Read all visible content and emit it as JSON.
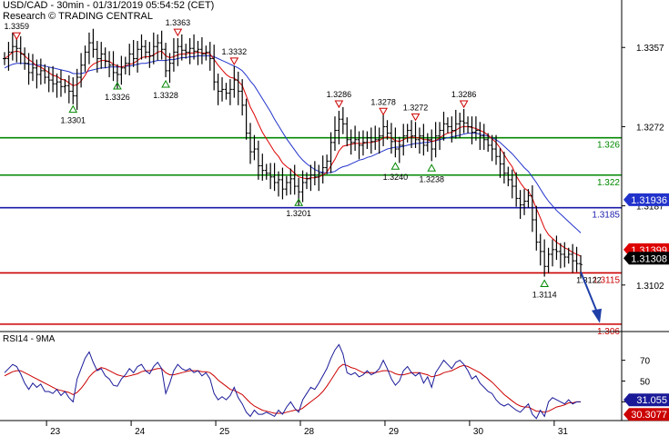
{
  "header": {
    "title": "USD/CAD - 30min - 01/31/2019 05:54:52 (CET)",
    "subtitle": "Research © TRADING CENTRAL"
  },
  "rsi_title": "RSI14 - 9MA",
  "colors": {
    "price": "#000000",
    "ma_fast": "#dd0000",
    "ma_slow": "#2233cc",
    "support_green": "#008800",
    "pivot_blue": "#1a1aaa",
    "resistance_red": "#cc0000",
    "arrow": "#1f3fa8",
    "rsi": "#1a1a99",
    "rsi_ma": "#cc0000"
  },
  "chart_data": [
    {
      "type": "line",
      "panel": "price",
      "ylim": [
        1.3055,
        1.3405
      ],
      "x_labels": [
        "23",
        "24",
        "25",
        "28",
        "29",
        "30",
        "31"
      ],
      "y_ticks": [
        1.3357,
        1.3272,
        1.3187,
        1.3102
      ],
      "right_scale_labels": [
        "1.3357",
        "1.3272",
        "1.3187",
        "1.3102"
      ],
      "current_price": "1.31308",
      "fast_ma_value": "1.31399",
      "slow_ma_value": "1.31936",
      "levels": [
        {
          "value": 1.326,
          "label": "1.326",
          "color": "#008800"
        },
        {
          "value": 1.322,
          "label": "1.322",
          "color": "#008800"
        },
        {
          "value": 1.3185,
          "label": "1.3185",
          "color": "#1a1aaa"
        },
        {
          "value": 1.3115,
          "label": "1.3115",
          "color": "#cc0000"
        },
        {
          "value": 1.306,
          "label": "1.306",
          "color": "#cc0000"
        }
      ],
      "annotations": [
        {
          "text": "1.3359",
          "i": 3,
          "y": 1.3359,
          "kind": "high"
        },
        {
          "text": "1.3363",
          "i": 43,
          "y": 1.3363,
          "kind": "high"
        },
        {
          "text": "1.3332",
          "i": 57,
          "y": 1.3332,
          "kind": "high"
        },
        {
          "text": "1.3301",
          "i": 17,
          "y": 1.3301,
          "kind": "low"
        },
        {
          "text": "1.3326",
          "i": 28,
          "y": 1.3326,
          "kind": "low"
        },
        {
          "text": "1.3328",
          "i": 40,
          "y": 1.3328,
          "kind": "low"
        },
        {
          "text": "1.3286",
          "i": 83,
          "y": 1.3286,
          "kind": "high"
        },
        {
          "text": "1.3278",
          "i": 94,
          "y": 1.3278,
          "kind": "high"
        },
        {
          "text": "1.3272",
          "i": 102,
          "y": 1.3272,
          "kind": "high"
        },
        {
          "text": "1.3286",
          "i": 114,
          "y": 1.3286,
          "kind": "high"
        },
        {
          "text": "1.3201",
          "i": 73,
          "y": 1.3201,
          "kind": "low"
        },
        {
          "text": "1.3240",
          "i": 97,
          "y": 1.324,
          "kind": "low"
        },
        {
          "text": "1.3238",
          "i": 106,
          "y": 1.3238,
          "kind": "low"
        },
        {
          "text": "1.3114",
          "i": 134,
          "y": 1.3114,
          "kind": "low"
        },
        {
          "text": "1.3122",
          "i": 141,
          "y": 1.3122,
          "kind": "label"
        }
      ],
      "forecast_arrow": {
        "from": 1.3122,
        "to": 1.3063
      },
      "close": [
        1.3345,
        1.3352,
        1.3358,
        1.3356,
        1.335,
        1.334,
        1.333,
        1.3335,
        1.3328,
        1.3332,
        1.3325,
        1.3322,
        1.3318,
        1.332,
        1.3315,
        1.3316,
        1.331,
        1.3305,
        1.3325,
        1.3338,
        1.3352,
        1.3362,
        1.3355,
        1.3345,
        1.335,
        1.3342,
        1.3338,
        1.333,
        1.3328,
        1.3335,
        1.334,
        1.335,
        1.3345,
        1.3355,
        1.3358,
        1.3352,
        1.3348,
        1.3358,
        1.3362,
        1.3355,
        1.3332,
        1.334,
        1.3352,
        1.3358,
        1.3354,
        1.3352,
        1.3356,
        1.3353,
        1.3355,
        1.335,
        1.3352,
        1.3345,
        1.332,
        1.331,
        1.3312,
        1.3308,
        1.3312,
        1.3322,
        1.331,
        1.3295,
        1.3265,
        1.3245,
        1.3248,
        1.323,
        1.3225,
        1.3222,
        1.3218,
        1.3212,
        1.3215,
        1.3205,
        1.3212,
        1.3216,
        1.3208,
        1.3202,
        1.3212,
        1.3216,
        1.322,
        1.3218,
        1.3222,
        1.3228,
        1.3235,
        1.3255,
        1.3268,
        1.328,
        1.3275,
        1.3258,
        1.3255,
        1.3258,
        1.3252,
        1.3255,
        1.326,
        1.3256,
        1.3258,
        1.3262,
        1.3272,
        1.3265,
        1.3256,
        1.3248,
        1.3252,
        1.3262,
        1.3268,
        1.3262,
        1.3258,
        1.3262,
        1.3252,
        1.3258,
        1.3248,
        1.3262,
        1.3268,
        1.3275,
        1.3272,
        1.3268,
        1.3275,
        1.3278,
        1.3276,
        1.3272,
        1.3266,
        1.3268,
        1.3262,
        1.3258,
        1.3252,
        1.3248,
        1.324,
        1.3232,
        1.3222,
        1.3215,
        1.3208,
        1.3195,
        1.3188,
        1.3192,
        1.3198,
        1.3172,
        1.3148,
        1.3138,
        1.3122,
        1.3135,
        1.314,
        1.3138,
        1.3135,
        1.3132,
        1.3135,
        1.3128,
        1.3125,
        1.3124
      ],
      "fast_ma": [
        1.3345,
        1.3348,
        1.3352,
        1.3353,
        1.3352,
        1.3348,
        1.3344,
        1.3341,
        1.3337,
        1.3336,
        1.3333,
        1.333,
        1.3327,
        1.3326,
        1.3323,
        1.3322,
        1.3319,
        1.3316,
        1.3317,
        1.3321,
        1.3327,
        1.3335,
        1.3339,
        1.3341,
        1.3343,
        1.3343,
        1.3342,
        1.3339,
        1.3337,
        1.3336,
        1.3337,
        1.3339,
        1.334,
        1.3343,
        1.3346,
        1.3347,
        1.3347,
        1.3349,
        1.3352,
        1.3353,
        1.3348,
        1.3346,
        1.3347,
        1.3349,
        1.335,
        1.335,
        1.3351,
        1.3351,
        1.3352,
        1.3351,
        1.3351,
        1.335,
        1.3344,
        1.3338,
        1.3333,
        1.3328,
        1.3325,
        1.3324,
        1.3321,
        1.3316,
        1.3305,
        1.3293,
        1.3285,
        1.3275,
        1.3266,
        1.3259,
        1.3252,
        1.3245,
        1.324,
        1.3233,
        1.3229,
        1.3226,
        1.3222,
        1.3218,
        1.3217,
        1.3216,
        1.3217,
        1.3217,
        1.3218,
        1.322,
        1.3223,
        1.323,
        1.3237,
        1.3246,
        1.3251,
        1.3252,
        1.3253,
        1.3254,
        1.3254,
        1.3254,
        1.3255,
        1.3255,
        1.3256,
        1.3257,
        1.326,
        1.3261,
        1.326,
        1.3257,
        1.3256,
        1.3258,
        1.326,
        1.3261,
        1.326,
        1.326,
        1.3258,
        1.3258,
        1.3256,
        1.3257,
        1.326,
        1.3263,
        1.3265,
        1.3266,
        1.3268,
        1.3271,
        1.3272,
        1.3272,
        1.3271,
        1.327,
        1.3268,
        1.3266,
        1.3263,
        1.3259,
        1.3255,
        1.3249,
        1.3242,
        1.3235,
        1.3229,
        1.3219,
        1.3212,
        1.3206,
        1.3203,
        1.3195,
        1.3184,
        1.3174,
        1.3163,
        1.3156,
        1.3152,
        1.3148,
        1.3145,
        1.3142,
        1.314,
        1.3137,
        1.3135,
        1.3133
      ],
      "slow_ma": [
        1.3335,
        1.3337,
        1.3339,
        1.334,
        1.334,
        1.334,
        1.3339,
        1.3339,
        1.3338,
        1.3338,
        1.3337,
        1.3336,
        1.3335,
        1.3334,
        1.3333,
        1.3332,
        1.3331,
        1.3329,
        1.3329,
        1.3329,
        1.333,
        1.3332,
        1.3333,
        1.3334,
        1.3335,
        1.3335,
        1.3336,
        1.3336,
        1.3336,
        1.3336,
        1.3337,
        1.3337,
        1.3338,
        1.3339,
        1.334,
        1.334,
        1.3341,
        1.3342,
        1.3343,
        1.3343,
        1.3343,
        1.3344,
        1.3344,
        1.3345,
        1.3346,
        1.3346,
        1.3347,
        1.3347,
        1.3348,
        1.3348,
        1.3348,
        1.3348,
        1.3347,
        1.3345,
        1.3343,
        1.3341,
        1.3339,
        1.3337,
        1.3335,
        1.3332,
        1.3327,
        1.3321,
        1.3316,
        1.3309,
        1.3302,
        1.3295,
        1.3288,
        1.328,
        1.3273,
        1.3266,
        1.3259,
        1.3253,
        1.3247,
        1.3241,
        1.3236,
        1.3232,
        1.3229,
        1.3226,
        1.3224,
        1.3223,
        1.3222,
        1.3223,
        1.3224,
        1.3227,
        1.3229,
        1.323,
        1.3232,
        1.3234,
        1.3236,
        1.3237,
        1.3239,
        1.324,
        1.3242,
        1.3244,
        1.3246,
        1.3248,
        1.3249,
        1.325,
        1.325,
        1.3251,
        1.3252,
        1.3253,
        1.3254,
        1.3254,
        1.3255,
        1.3255,
        1.3256,
        1.3257,
        1.3258,
        1.3259,
        1.326,
        1.3261,
        1.3262,
        1.3263,
        1.3264,
        1.3265,
        1.3265,
        1.3265,
        1.3264,
        1.3263,
        1.3262,
        1.326,
        1.3258,
        1.3255,
        1.3251,
        1.3247,
        1.3243,
        1.3238,
        1.3233,
        1.3228,
        1.3224,
        1.3218,
        1.3212,
        1.3205,
        1.3198,
        1.3192,
        1.3187,
        1.3182,
        1.3178,
        1.3174,
        1.317,
        1.3166,
        1.3162,
        1.3158
      ]
    },
    {
      "type": "line",
      "panel": "rsi",
      "ylim": [
        12,
        95
      ],
      "y_ticks": [
        70,
        50,
        30
      ],
      "current_rsi": "31.055",
      "current_ma": "30.3077",
      "rsi": [
        58,
        62,
        66,
        64,
        57,
        48,
        42,
        48,
        44,
        47,
        40,
        40,
        38,
        42,
        36,
        40,
        34,
        30,
        52,
        62,
        72,
        78,
        68,
        60,
        62,
        55,
        52,
        46,
        45,
        52,
        56,
        62,
        58,
        64,
        66,
        60,
        57,
        64,
        68,
        62,
        38,
        48,
        60,
        66,
        62,
        60,
        62,
        58,
        60,
        55,
        58,
        52,
        38,
        32,
        35,
        32,
        36,
        44,
        34,
        28,
        20,
        16,
        22,
        18,
        18,
        20,
        18,
        16,
        22,
        18,
        25,
        30,
        24,
        20,
        32,
        38,
        44,
        42,
        48,
        55,
        62,
        72,
        80,
        85,
        76,
        58,
        56,
        58,
        54,
        56,
        60,
        56,
        58,
        62,
        70,
        62,
        52,
        46,
        50,
        60,
        64,
        58,
        55,
        58,
        48,
        54,
        44,
        58,
        64,
        70,
        66,
        62,
        68,
        70,
        66,
        60,
        52,
        55,
        48,
        44,
        40,
        38,
        32,
        28,
        26,
        28,
        25,
        22,
        20,
        24,
        28,
        18,
        14,
        22,
        16,
        30,
        34,
        32,
        30,
        28,
        32,
        28,
        30,
        30
      ],
      "rsi_ma": [
        55,
        57,
        59,
        60,
        60,
        58,
        56,
        54,
        52,
        50,
        48,
        46,
        44,
        42,
        41,
        40,
        39,
        37,
        39,
        43,
        48,
        54,
        58,
        61,
        63,
        62,
        60,
        58,
        56,
        55,
        54,
        55,
        56,
        57,
        59,
        60,
        60,
        61,
        62,
        62,
        58,
        56,
        56,
        57,
        58,
        59,
        60,
        60,
        60,
        59,
        59,
        58,
        55,
        51,
        48,
        45,
        42,
        41,
        39,
        37,
        33,
        29,
        26,
        24,
        22,
        21,
        20,
        19,
        19,
        19,
        20,
        21,
        22,
        22,
        24,
        27,
        30,
        33,
        36,
        40,
        45,
        51,
        57,
        63,
        66,
        65,
        63,
        62,
        60,
        58,
        58,
        58,
        58,
        59,
        60,
        60,
        59,
        57,
        56,
        56,
        57,
        58,
        58,
        58,
        57,
        56,
        54,
        55,
        56,
        58,
        59,
        60,
        62,
        64,
        65,
        64,
        62,
        60,
        58,
        55,
        52,
        49,
        45,
        41,
        37,
        34,
        31,
        28,
        26,
        25,
        25,
        23,
        21,
        21,
        20,
        21,
        23,
        25,
        26,
        27,
        29,
        29,
        30,
        30
      ]
    }
  ]
}
